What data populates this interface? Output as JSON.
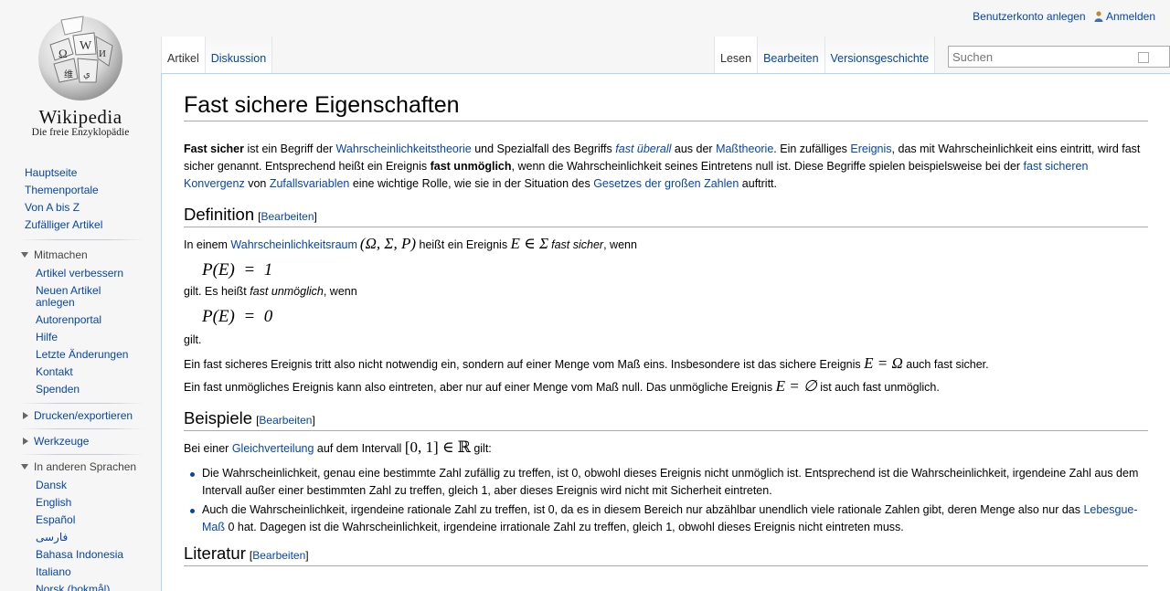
{
  "logo": {
    "wordmark": "Wikipedia",
    "tagline": "Die freie Enzyklopädie",
    "globe_icon": "wikipedia-globe-icon"
  },
  "personal": {
    "create_account": "Benutzerkonto anlegen",
    "login": "Anmelden"
  },
  "tabs": {
    "article": "Artikel",
    "discussion": "Diskussion",
    "read": "Lesen",
    "edit": "Bearbeiten",
    "history": "Versionsgeschichte"
  },
  "search": {
    "placeholder": "Suchen"
  },
  "sidebar": {
    "main": [
      "Hauptseite",
      "Themenportale",
      "Von A bis Z",
      "Zufälliger Artikel"
    ],
    "mitmachen_label": "Mitmachen",
    "mitmachen": [
      "Artikel verbessern",
      "Neuen Artikel anlegen",
      "Autorenportal",
      "Hilfe",
      "Letzte Änderungen",
      "Kontakt",
      "Spenden"
    ],
    "print_label": "Drucken/exportieren",
    "tools_label": "Werkzeuge",
    "languages_label": "In anderen Sprachen",
    "languages": [
      "Dansk",
      "English",
      "Español",
      "فارسی",
      "Bahasa Indonesia",
      "Italiano",
      "Norsk (bokmål)"
    ]
  },
  "article": {
    "title": "Fast sichere Eigenschaften",
    "lead": {
      "b1": "Fast sicher",
      "t1": " ist ein Begriff der ",
      "l1": "Wahrscheinlichkeitstheorie",
      "t2": " und Spezialfall des Begriffs ",
      "l2": "fast überall",
      "t3": " aus der ",
      "l3": "Maßtheorie",
      "t4": ". Ein zufälliges ",
      "l4": "Ereignis",
      "t5": ", das mit Wahrscheinlichkeit eins eintritt, wird fast sicher genannt. Entsprechend heißt ein Ereignis ",
      "b2": "fast unmöglich",
      "t6": ", wenn die Wahrscheinlichkeit seines Eintretens null ist. Diese Begriffe spielen beispielsweise bei der ",
      "l5": "fast sicheren Konvergenz",
      "t7": " von ",
      "l6": "Zufallsvariablen",
      "t8": " eine wichtige Rolle, wie sie in der Situation des ",
      "l7": "Gesetzes der großen Zahlen",
      "t9": " auftritt."
    },
    "edit_link": "Bearbeiten",
    "definition": {
      "heading": "Definition",
      "p1_a": "In einem ",
      "p1_link": "Wahrscheinlichkeitsraum",
      "p1_math1": "(Ω, Σ, P)",
      "p1_b": " heißt ein Ereignis ",
      "p1_math2": "E ∈ Σ",
      "p1_c": "fast sicher",
      "p1_d": ", wenn",
      "f1": "P(E)  =  1",
      "p2_a": "gilt. Es heißt ",
      "p2_i": "fast unmöglich",
      "p2_b": ", wenn",
      "f2": "P(E)  =  0",
      "p3": "gilt.",
      "p4_a": "Ein fast sicheres Ereignis tritt also nicht notwendig ein, sondern auf einer Menge vom Maß eins. Insbesondere ist das sichere Ereignis ",
      "p4_math": "E = Ω",
      "p4_b": " auch fast sicher.",
      "p5_a": "Ein fast unmögliches Ereignis kann also eintreten, aber nur auf einer Menge vom Maß null. Das unmögliche Ereignis ",
      "p5_math": "E = ∅",
      "p5_b": " ist auch fast unmöglich."
    },
    "beispiele": {
      "heading": "Beispiele",
      "p_a": "Bei einer ",
      "p_link": "Gleichverteilung",
      "p_b": " auf dem Intervall ",
      "p_math": "[0, 1] ∈ ℝ",
      "p_c": " gilt:",
      "li1": "Die Wahrscheinlichkeit, genau eine bestimmte Zahl zufällig zu treffen, ist 0, obwohl dieses Ereignis nicht unmöglich ist. Entsprechend ist die Wahrscheinlichkeit, irgendeine Zahl aus dem Intervall außer einer bestimmten Zahl zu treffen, gleich 1, aber dieses Ereignis wird nicht mit Sicherheit eintreten.",
      "li2_a": "Auch die Wahrscheinlichkeit, irgendeine rationale Zahl zu treffen, ist 0, da es in diesem Bereich nur abzählbar unendlich viele rationale Zahlen gibt, deren Menge also nur das ",
      "li2_link": "Lebesgue-Maß",
      "li2_b": " 0 hat. Dagegen ist die Wahrscheinlichkeit, irgendeine irrationale Zahl zu treffen, gleich 1, obwohl dieses Ereignis nicht eintreten muss."
    },
    "literatur": {
      "heading": "Literatur"
    }
  }
}
